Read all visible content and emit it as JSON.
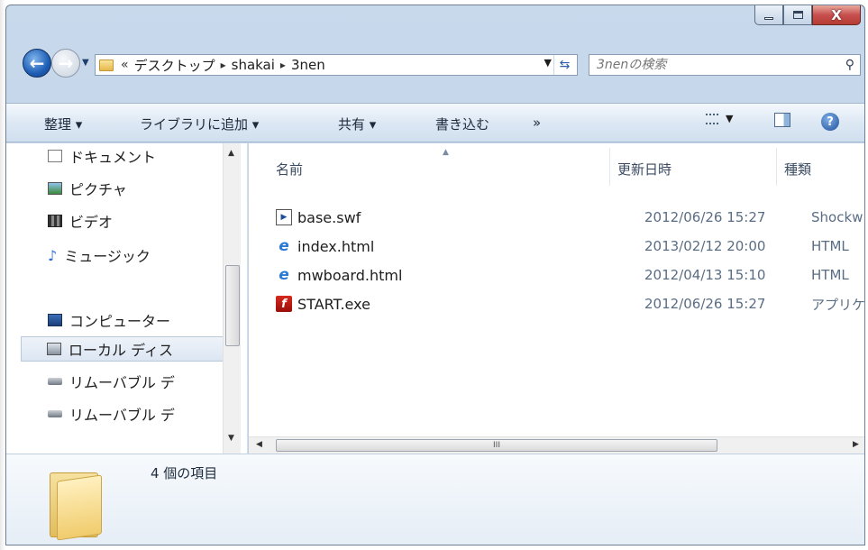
{
  "window": {
    "minimize_glyph": "—",
    "maximize_glyph": "□",
    "close_glyph": "X"
  },
  "address": {
    "crumb_overflow": "«",
    "crumbs": [
      "デスクトップ",
      "shakai",
      "3nen"
    ],
    "separator": "▸"
  },
  "search": {
    "placeholder": "3nenの検索"
  },
  "toolbar": {
    "organize": "整理 ▾",
    "add_to_library": "ライブラリに追加 ▾",
    "share": "共有 ▾",
    "burn": "書き込む",
    "more": "»"
  },
  "nav": {
    "items": [
      {
        "label": "ドキュメント",
        "icon": "document-icon"
      },
      {
        "label": "ピクチャ",
        "icon": "pictures-icon"
      },
      {
        "label": "ビデオ",
        "icon": "video-icon"
      },
      {
        "label": "ミュージック",
        "icon": "music-icon"
      },
      {
        "label": "コンピューター",
        "icon": "computer-icon"
      },
      {
        "label": "ローカル ディス",
        "icon": "local-disk-icon"
      },
      {
        "label": "リムーバブル デ",
        "icon": "removable-drive-icon"
      },
      {
        "label": "リムーバブル デ",
        "icon": "removable-drive-icon"
      }
    ]
  },
  "columns": {
    "name": "名前",
    "modified": "更新日時",
    "type": "種類"
  },
  "files": [
    {
      "name": "base.swf",
      "modified": "2012/06/26 15:27",
      "type": "Shockw",
      "icon": "swf-file-icon"
    },
    {
      "name": "index.html",
      "modified": "2013/02/12 20:00",
      "type": "HTML",
      "icon": "ie-html-icon"
    },
    {
      "name": "mwboard.html",
      "modified": "2012/04/13 15:10",
      "type": "HTML",
      "icon": "ie-html-icon"
    },
    {
      "name": "START.exe",
      "modified": "2012/06/26 15:27",
      "type": "アプリケ",
      "icon": "flash-exe-icon"
    }
  ],
  "details": {
    "item_count": "4 個の項目"
  },
  "scroll": {
    "hthumb_grip": "III"
  }
}
